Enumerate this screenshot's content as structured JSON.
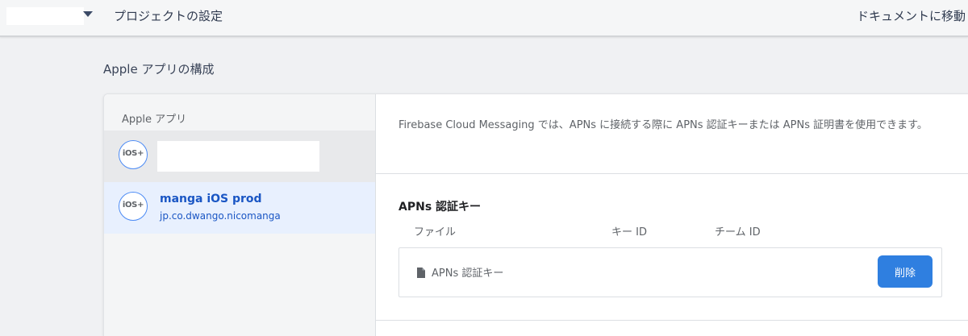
{
  "header": {
    "page_title": "プロジェクトの設定",
    "docs_link": "ドキュメントに移動"
  },
  "section": {
    "title": "Apple アプリの構成"
  },
  "sidebar": {
    "heading": "Apple アプリ",
    "apps": [
      {
        "badge": "iOS+",
        "name": "",
        "bundle_id": ""
      },
      {
        "badge": "iOS+",
        "name": "manga iOS prod",
        "bundle_id": "jp.co.dwango.nicomanga"
      }
    ]
  },
  "content": {
    "description": "Firebase Cloud Messaging では、APNs に接続する際に APNs 認証キーまたは APNs 証明書を使用できます。",
    "apns_key": {
      "heading": "APNs 認証キー",
      "columns": [
        "ファイル",
        "キー ID",
        "チーム ID"
      ],
      "file_name": "APNs 認証キー",
      "delete_label": "削除"
    }
  },
  "colors": {
    "accent": "#2f7fe0",
    "link": "#1a56c4",
    "selected_bg": "#e8f0fe"
  }
}
